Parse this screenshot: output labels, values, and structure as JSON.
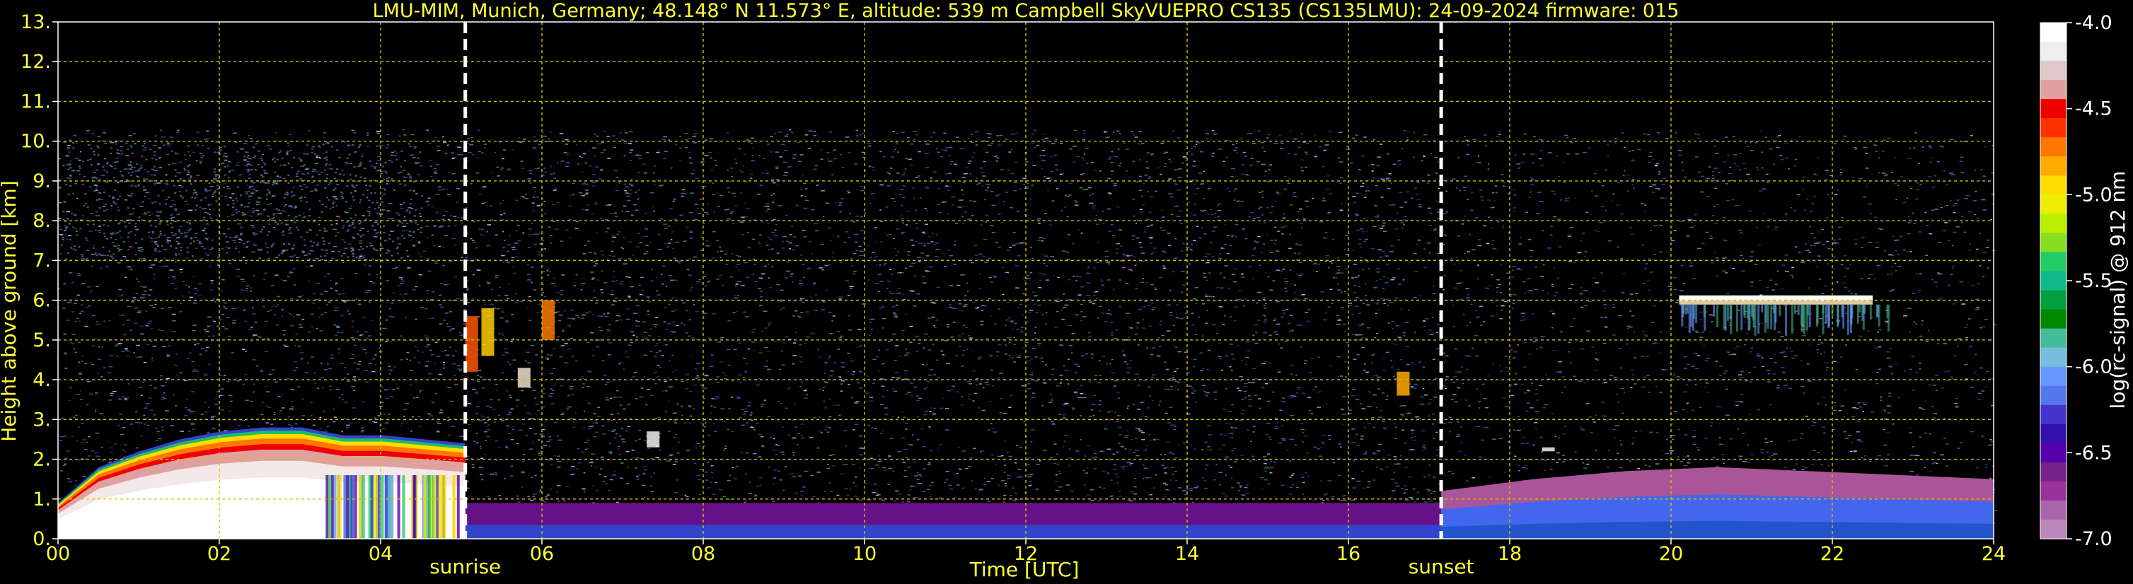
{
  "chart_data": {
    "type": "heatmap",
    "title": "LMU-MIM, Munich, Germany; 48.148° N 11.573° E, altitude: 539 m    Campbell SkyVUEPRO CS135 (CS135LMU): 24-09-2024    firmware: 015",
    "xlabel": "Time [UTC]",
    "ylabel": "Height above ground [km]",
    "colorbar_label": "log(rc-signal) @ 912 nm",
    "xlim": [
      0,
      24
    ],
    "ylim": [
      0,
      13
    ],
    "x_ticks": [
      "00",
      "02",
      "04",
      "06",
      "08",
      "10",
      "12",
      "14",
      "16",
      "18",
      "20",
      "22",
      "24"
    ],
    "y_ticks": [
      "0.",
      "1.",
      "2.",
      "3.",
      "4.",
      "5.",
      "6.",
      "7.",
      "8.",
      "9.",
      "10.",
      "11.",
      "12.",
      "13."
    ],
    "colorbar_ticks": [
      "-4.0",
      "-4.5",
      "-5.0",
      "-5.5",
      "-6.0",
      "-6.5",
      "-7.0"
    ],
    "colorbar_range": [
      -7.0,
      -4.0
    ],
    "grid": true,
    "grid_color": "#d4c400",
    "text_color": "#ffff33",
    "colorbar_colors": [
      "#ffffff",
      "#eeeeee",
      "#e0c8c8",
      "#e0a0a0",
      "#ee0000",
      "#ff3300",
      "#ff7700",
      "#ffaa00",
      "#ffdd00",
      "#eeee00",
      "#bbee00",
      "#88dd22",
      "#22cc66",
      "#11bb88",
      "#00a040",
      "#008800",
      "#44bb99",
      "#77bbdd",
      "#6699ff",
      "#5577ee",
      "#4433cc",
      "#3311aa",
      "#5500aa",
      "#772288",
      "#993399",
      "#aa66aa",
      "#bb88bb"
    ],
    "events": [
      {
        "name": "sunrise",
        "time": 5.05
      },
      {
        "name": "sunset",
        "time": 17.15
      }
    ],
    "layers": [
      {
        "name": "noise_region",
        "t0": 0,
        "t1": 24,
        "h0": 0.4,
        "h1": 10.3
      },
      {
        "name": "boundary_layer_morning",
        "t0": 0,
        "t1": 5.05,
        "top_km": [
          0.9,
          1.8,
          2.2,
          2.5,
          2.7,
          2.8,
          2.8,
          2.6,
          2.6,
          2.5,
          2.4
        ]
      },
      {
        "name": "boundary_layer_day",
        "t0": 5.05,
        "t1": 17.15,
        "top_km": 0.9
      },
      {
        "name": "boundary_layer_evening",
        "t0": 17.15,
        "t1": 24,
        "top_km": [
          1.2,
          1.5,
          1.7,
          1.8,
          1.7,
          1.6,
          1.5
        ]
      },
      {
        "name": "cloud_layer_evening",
        "t0": 20.1,
        "t1": 22.5,
        "h_km": 6.05
      },
      {
        "name": "cirrus_morning",
        "t0": 0,
        "t1": 4.5,
        "h0": 7.0,
        "h1": 10.0
      }
    ]
  }
}
